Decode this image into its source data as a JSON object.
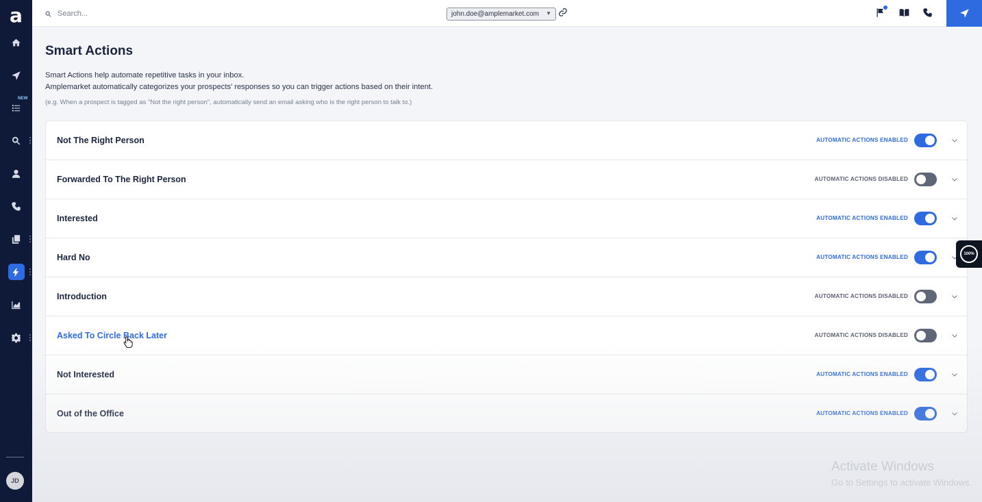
{
  "sidebar": {
    "logo": "a",
    "new_badge": "NEW",
    "items": [
      {
        "name": "home",
        "icon": "home-icon"
      },
      {
        "name": "sequences",
        "icon": "send-icon"
      },
      {
        "name": "tasks",
        "icon": "list-icon"
      },
      {
        "name": "search",
        "icon": "search-icon"
      },
      {
        "name": "contacts",
        "icon": "person-icon"
      },
      {
        "name": "calls",
        "icon": "phone-icon"
      },
      {
        "name": "templates",
        "icon": "copy-icon"
      },
      {
        "name": "smart-actions",
        "icon": "lightning-icon",
        "active": true
      },
      {
        "name": "analytics",
        "icon": "chart-icon"
      },
      {
        "name": "settings",
        "icon": "gear-icon"
      }
    ],
    "avatar_initials": "JD"
  },
  "topbar": {
    "search_placeholder": "Search...",
    "account": "john.doe@amplemarket.com",
    "icons": [
      "flag-icon",
      "book-icon",
      "phone-icon",
      "send-icon"
    ]
  },
  "main": {
    "title": "Smart Actions",
    "description_line1": "Smart Actions help automate repetitive tasks in your inbox.",
    "description_line2": "Amplemarket automatically categorizes your prospects' responses so you can trigger actions based on their intent.",
    "example": "(e.g. When a prospect is tagged as \"Not the right person\", automatically send an email asking who is the right person to talk to.)",
    "rows": [
      {
        "name": "Not The Right Person",
        "status": "AUTOMATIC ACTIONS ENABLED",
        "enabled": true
      },
      {
        "name": "Forwarded To The Right Person",
        "status": "AUTOMATIC ACTIONS DISABLED",
        "enabled": false
      },
      {
        "name": "Interested",
        "status": "AUTOMATIC ACTIONS ENABLED",
        "enabled": true
      },
      {
        "name": "Hard No",
        "status": "AUTOMATIC ACTIONS ENABLED",
        "enabled": true
      },
      {
        "name": "Introduction",
        "status": "AUTOMATIC ACTIONS DISABLED",
        "enabled": false
      },
      {
        "name": "Asked To Circle Back Later",
        "status": "AUTOMATIC ACTIONS DISABLED",
        "enabled": false,
        "hover": true
      },
      {
        "name": "Not Interested",
        "status": "AUTOMATIC ACTIONS ENABLED",
        "enabled": true
      },
      {
        "name": "Out of the Office",
        "status": "AUTOMATIC ACTIONS ENABLED",
        "enabled": true
      }
    ]
  },
  "overlay": {
    "zoom": "100%",
    "watermark_line1": "Activate Windows",
    "watermark_line2": "Go to Settings to activate Windows."
  },
  "colors": {
    "sidebar_bg": "#0f1a38",
    "accent": "#2f6be0",
    "toggle_off": "#5f6678"
  }
}
